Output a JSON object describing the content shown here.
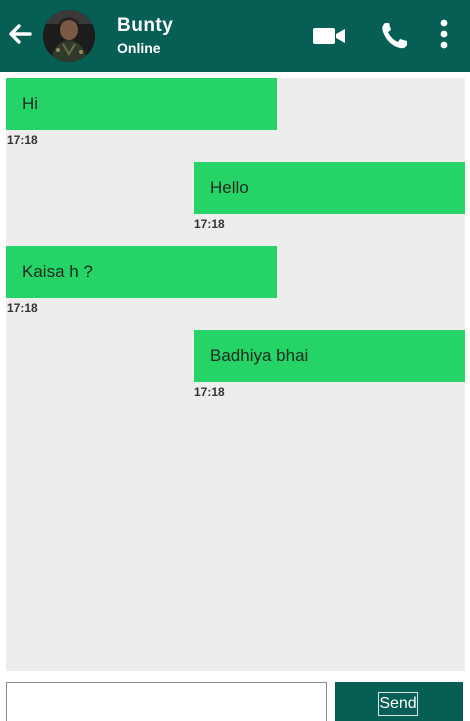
{
  "header": {
    "contact_name": "Bunty",
    "contact_status": "Online",
    "icons": {
      "back": "arrow-left-icon",
      "video": "video-camera-icon",
      "call": "phone-icon",
      "menu": "more-vertical-icon"
    },
    "colors": {
      "bar": "#075e54",
      "text": "#ffffff"
    }
  },
  "messages": [
    {
      "direction": "incoming",
      "text": "Hi",
      "time": "17:18"
    },
    {
      "direction": "outgoing",
      "text": "Hello",
      "time": "17:18"
    },
    {
      "direction": "incoming",
      "text": "Kaisa h ?",
      "time": "17:18"
    },
    {
      "direction": "outgoing",
      "text": "Badhiya bhai",
      "time": "17:18"
    }
  ],
  "composer": {
    "input_value": "",
    "placeholder": "",
    "send_label": "Send"
  },
  "colors": {
    "bubble": "#25d366",
    "chat_bg": "#ededed"
  }
}
